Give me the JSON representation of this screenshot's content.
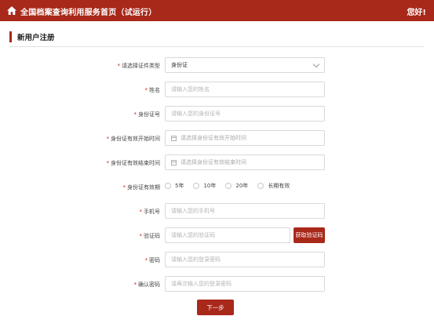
{
  "header": {
    "title": "全国档案查询利用服务首页（试运行）",
    "greeting": "您好!"
  },
  "section": {
    "title": "新用户注册"
  },
  "form": {
    "required_mark": "*",
    "doc_type": {
      "label": "请选择证件类型",
      "value": "身份证"
    },
    "name": {
      "label": "姓名",
      "placeholder": "请输入您的姓名"
    },
    "id_number": {
      "label": "身份证号",
      "placeholder": "请输入您的身份证号"
    },
    "id_start": {
      "label": "身份证有效开始时间",
      "placeholder": "请选择身份证有效开始时间"
    },
    "id_end": {
      "label": "身份证有效结束时间",
      "placeholder": "请选择身份证有效结束时间"
    },
    "validity": {
      "label": "身份证有效期",
      "options": [
        "5年",
        "10年",
        "20年",
        "长期有效"
      ]
    },
    "phone": {
      "label": "手机号",
      "placeholder": "请输入您的手机号"
    },
    "code": {
      "label": "验证码",
      "placeholder": "请输入您的验证码",
      "button": "获取验证码"
    },
    "password": {
      "label": "密码",
      "placeholder": "请输入您的登录密码"
    },
    "confirm": {
      "label": "确认密码",
      "placeholder": "请再次输入您的登录密码"
    },
    "next_button": "下一步"
  }
}
